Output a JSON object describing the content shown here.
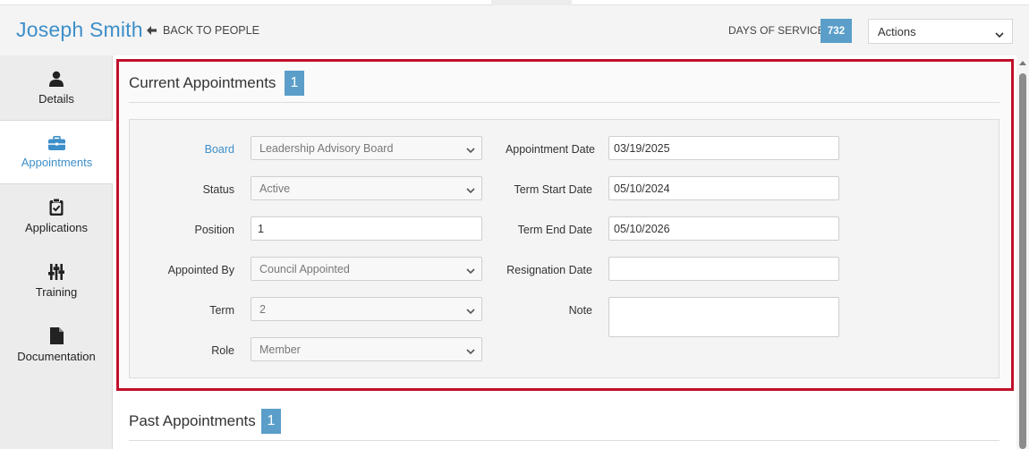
{
  "header": {
    "person_name": "Joseph Smith",
    "back_label": "BACK TO PEOPLE",
    "days_of_service_label": "DAYS OF SERVICE",
    "days_of_service_value": "732",
    "actions_label": "Actions"
  },
  "sidebar": {
    "items": [
      {
        "label": "Details",
        "icon": "person-icon"
      },
      {
        "label": "Appointments",
        "icon": "briefcase-icon",
        "active": true
      },
      {
        "label": "Applications",
        "icon": "clipboard-check-icon"
      },
      {
        "label": "Training",
        "icon": "sliders-icon"
      },
      {
        "label": "Documentation",
        "icon": "document-icon"
      }
    ]
  },
  "current": {
    "title": "Current Appointments",
    "count": "1",
    "fields_left": [
      {
        "label": "Board",
        "value": "Leadership Advisory Board",
        "type": "select"
      },
      {
        "label": "Status",
        "value": "Active",
        "type": "select"
      },
      {
        "label": "Position",
        "value": "1",
        "type": "text"
      },
      {
        "label": "Appointed By",
        "value": "Council Appointed",
        "type": "select"
      },
      {
        "label": "Term",
        "value": "2",
        "type": "select"
      },
      {
        "label": "Role",
        "value": "Member",
        "type": "select"
      }
    ],
    "fields_right": [
      {
        "label": "Appointment Date",
        "value": "03/19/2025"
      },
      {
        "label": "Term Start Date",
        "value": "05/10/2024"
      },
      {
        "label": "Term End Date",
        "value": "05/10/2026"
      },
      {
        "label": "Resignation Date",
        "value": ""
      },
      {
        "label": "Note",
        "value": ""
      }
    ]
  },
  "past": {
    "title": "Past Appointments",
    "count": "1"
  },
  "colors": {
    "accent": "#3d8fc9",
    "badge": "#5b9ec9",
    "highlight_border": "#c0102a"
  }
}
